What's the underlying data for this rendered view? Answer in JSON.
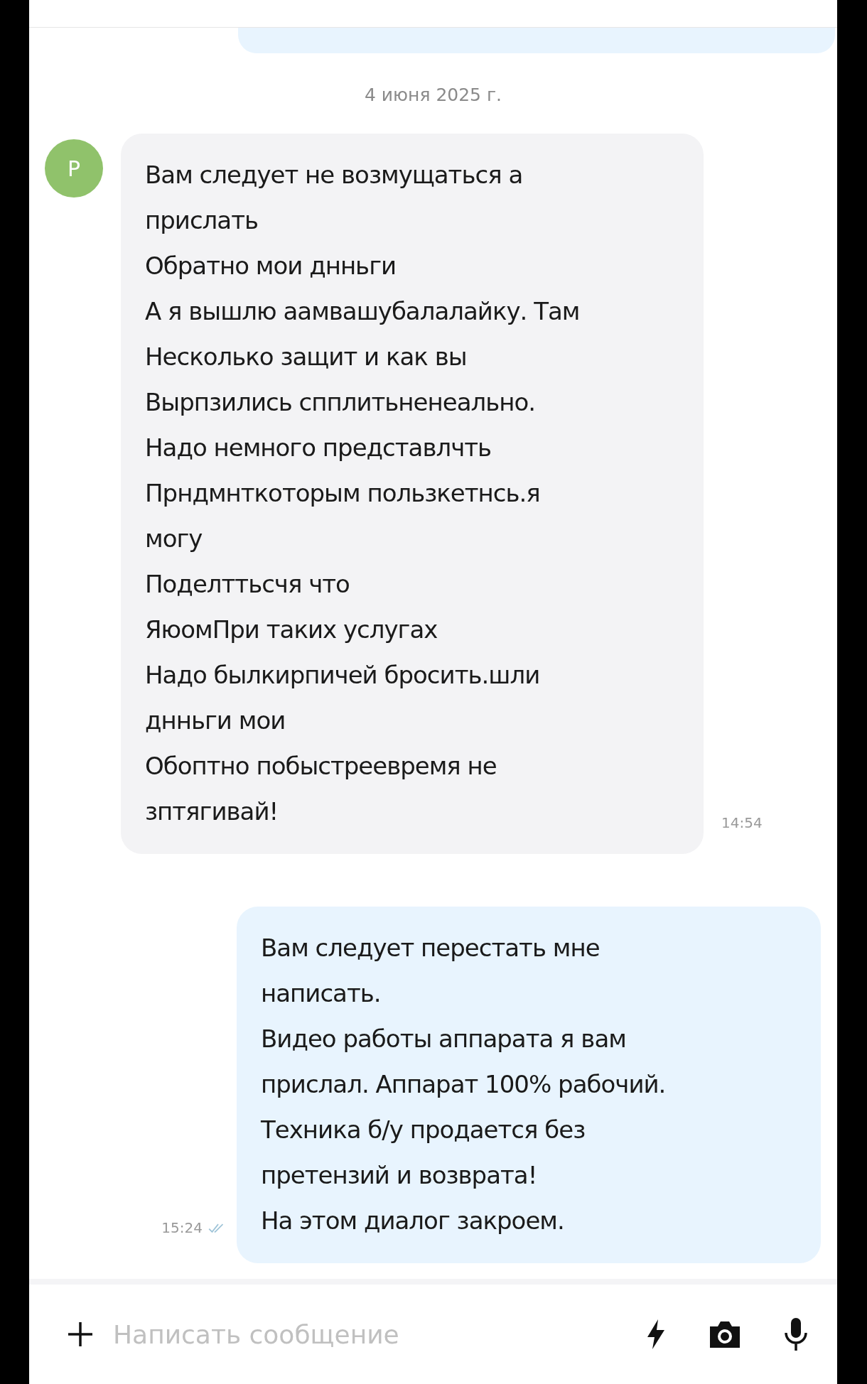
{
  "date_separator": "4 июня 2025 г.",
  "messages": [
    {
      "kind": "incoming",
      "avatar": "Р",
      "time": "14:54",
      "lines": [
        "Вам следует не возмущаться а",
        "прислать",
        "Обратно мои днньги",
        "А  я вышлю аамвашубалалайку. Там",
        "Несколько защит и как  вы",
        "Вырпзились спплитьненеально.",
        "Надо немного представлчть",
        "Прндмнткоторым пользкетнсь.я",
        "могу",
        "Поделттьсчя что",
        "ЯюомПри таких услугах",
        "Надо былкирпичей  бросить.шли",
        "днньги мои",
        "Обоптно побыстреевремя  не",
        "зптягивай!"
      ]
    },
    {
      "kind": "outgoing",
      "time": "15:24",
      "read": true,
      "lines": [
        "Вам следует перестать мне",
        "написать.",
        "Видео работы аппарата я вам",
        "прислал. Аппарат 100% рабочий.",
        "Техника б/у продается без",
        "претензий и возврата!",
        "На этом диалог закроем."
      ]
    }
  ],
  "composer": {
    "placeholder": "Написать сообщение"
  }
}
